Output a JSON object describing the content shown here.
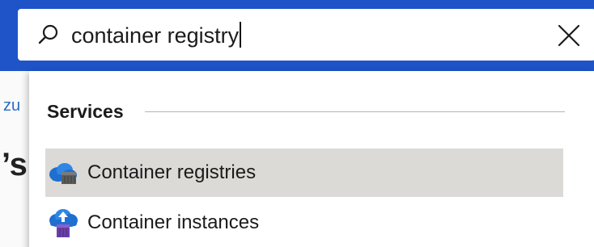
{
  "search": {
    "value": "container registry",
    "placeholder": ""
  },
  "background": {
    "breadcrumb_fragment": "zu",
    "heading_fragment": "’s"
  },
  "dropdown": {
    "section_title": "Services",
    "results": [
      {
        "label": "Container registries",
        "icon": "container-registry-icon",
        "selected": true
      },
      {
        "label": "Container instances",
        "icon": "container-instances-icon",
        "selected": false
      }
    ]
  },
  "colors": {
    "header_blue": "#1e54c8",
    "selected_row": "#dcdad7",
    "link_blue": "#2b6cc4"
  }
}
